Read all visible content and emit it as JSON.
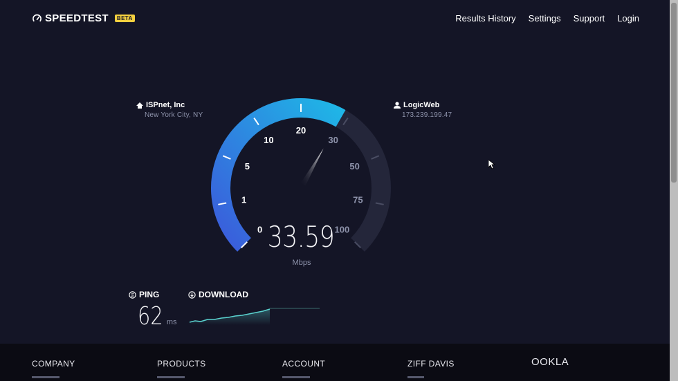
{
  "header": {
    "logo_text": "SPEEDTEST",
    "beta_label": "BETA",
    "nav": [
      {
        "label": "Results History"
      },
      {
        "label": "Settings"
      },
      {
        "label": "Support"
      },
      {
        "label": "Login"
      }
    ]
  },
  "isp": {
    "name": "ISPnet, Inc",
    "location": "New York City, NY",
    "icon": "home-icon"
  },
  "server": {
    "name": "LogicWeb",
    "ip": "173.239.199.47",
    "icon": "user-icon"
  },
  "gauge": {
    "value": "33.59",
    "unit": "Mbps",
    "ticks": [
      "0",
      "1",
      "5",
      "10",
      "20",
      "30",
      "50",
      "75",
      "100"
    ],
    "needle_at": 33.59,
    "progress_fraction": 0.61,
    "colors": {
      "arc_start": "#3b5bdb",
      "arc_end": "#1fb6e6",
      "track": "#24263a"
    }
  },
  "ping": {
    "label": "PING",
    "value": "62",
    "unit": "ms",
    "icon": "ping-icon"
  },
  "download": {
    "label": "DOWNLOAD",
    "icon": "download-icon",
    "graph_color": "#5ad2cf"
  },
  "footer": {
    "columns": [
      "COMPANY",
      "PRODUCTS",
      "ACCOUNT",
      "ZIFF DAVIS"
    ],
    "brand": "OOKLA"
  }
}
